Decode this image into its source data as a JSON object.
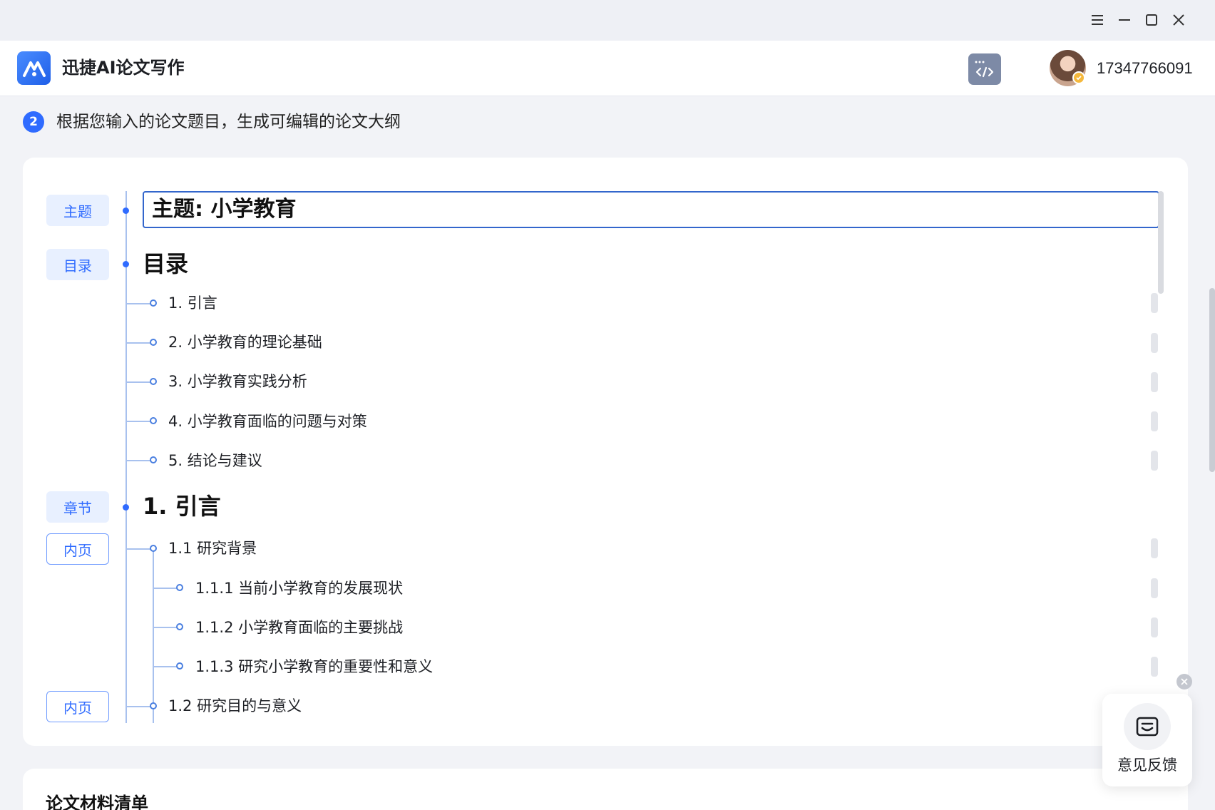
{
  "app": {
    "title": "迅捷AI论文写作"
  },
  "user": {
    "phone": "17347766091"
  },
  "step": {
    "number": "2",
    "text": "根据您输入的论文题目，生成可编辑的论文大纲"
  },
  "outline": {
    "tags": {
      "topic": "主题",
      "toc": "目录",
      "chapter": "章节",
      "page": "内页"
    },
    "topic_value": "主题: 小学教育",
    "toc_heading": "目录",
    "toc_items": [
      "1. 引言",
      "2. 小学教育的理论基础",
      "3. 小学教育实践分析",
      "4. 小学教育面临的问题与对策",
      "5. 结论与建议"
    ],
    "chapter_heading": "1. 引言",
    "section_1_1": "1.1 研究背景",
    "sub_items": [
      "1.1.1 当前小学教育的发展现状",
      "1.1.2 小学教育面临的主要挑战",
      "1.1.3 研究小学教育的重要性和意义"
    ],
    "section_1_2": "1.2 研究目的与意义"
  },
  "materials": {
    "title": "论文材料清单"
  },
  "feedback": {
    "label": "意见反馈"
  },
  "icons": {
    "menu": "menu-icon",
    "minimize": "minimize-icon",
    "maximize": "maximize-icon",
    "close": "close-icon",
    "code": "code-icon",
    "feedback": "feedback-icon"
  },
  "colors": {
    "accent": "#2f6bff",
    "tag_bg": "#e8f0ff",
    "tree_line": "#a8c1ee"
  }
}
